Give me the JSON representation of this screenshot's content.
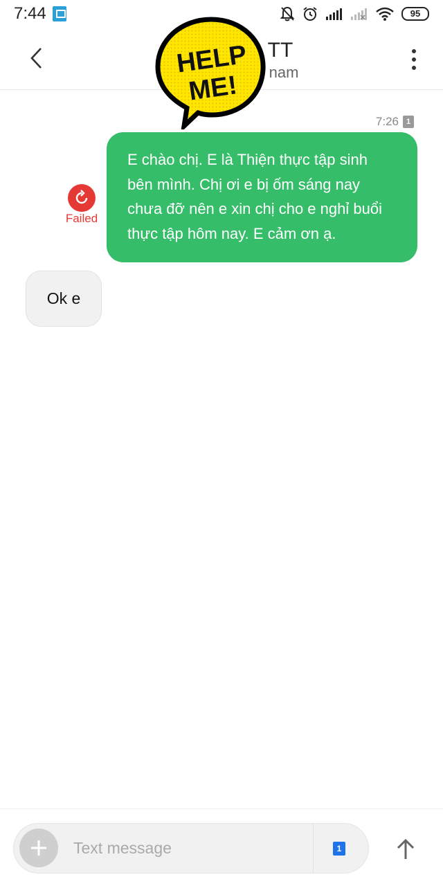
{
  "status_bar": {
    "time": "7:44",
    "battery": "95",
    "icons": [
      "sim-icon",
      "mute-bell-icon",
      "alarm-icon",
      "signal-icon",
      "signal-empty-icon",
      "wifi-icon",
      "battery-icon"
    ]
  },
  "header": {
    "contact_name": "TT",
    "contact_subtitle": "nam",
    "sticker_text_line1": "HELP",
    "sticker_text_line2": "ME!"
  },
  "conversation": {
    "outgoing": {
      "time": "7:26",
      "sim_slot": "1",
      "text": "E chào chị. E là Thiện thực tập sinh bên mình. Chị ơi e bị ốm sáng nay chưa đỡ nên e xin chị cho e nghỉ buổi thực tập hôm nay. E cảm ơn ạ.",
      "status": "Failed",
      "bubble_color": "#35bd6a"
    },
    "incoming": {
      "text": "Ok e"
    }
  },
  "compose": {
    "placeholder": "Text message",
    "sim_slot": "1"
  },
  "colors": {
    "accent_green": "#35bd6a",
    "error_red": "#e53935",
    "sim_blue": "#1e73e8"
  }
}
